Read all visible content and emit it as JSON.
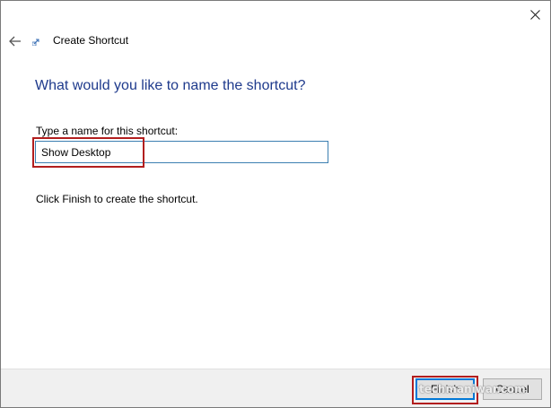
{
  "window": {
    "title": "Create Shortcut",
    "close_symbol": "×"
  },
  "icons": {
    "back": "back-arrow-icon",
    "app": "shortcut-app-icon",
    "close": "close-icon"
  },
  "content": {
    "heading": "What would you like to name the shortcut?",
    "field_label": "Type a name for this shortcut:",
    "name_value": "Show Desktop",
    "instruction": "Click Finish to create the shortcut."
  },
  "footer": {
    "finish_label": "Finish",
    "cancel_label": "Cancel"
  },
  "watermark": "techmaniwar.com",
  "colors": {
    "heading": "#1e3a8c",
    "highlight": "#b21e1e",
    "input_border": "#3c7fb1",
    "focus": "#0078d7"
  }
}
